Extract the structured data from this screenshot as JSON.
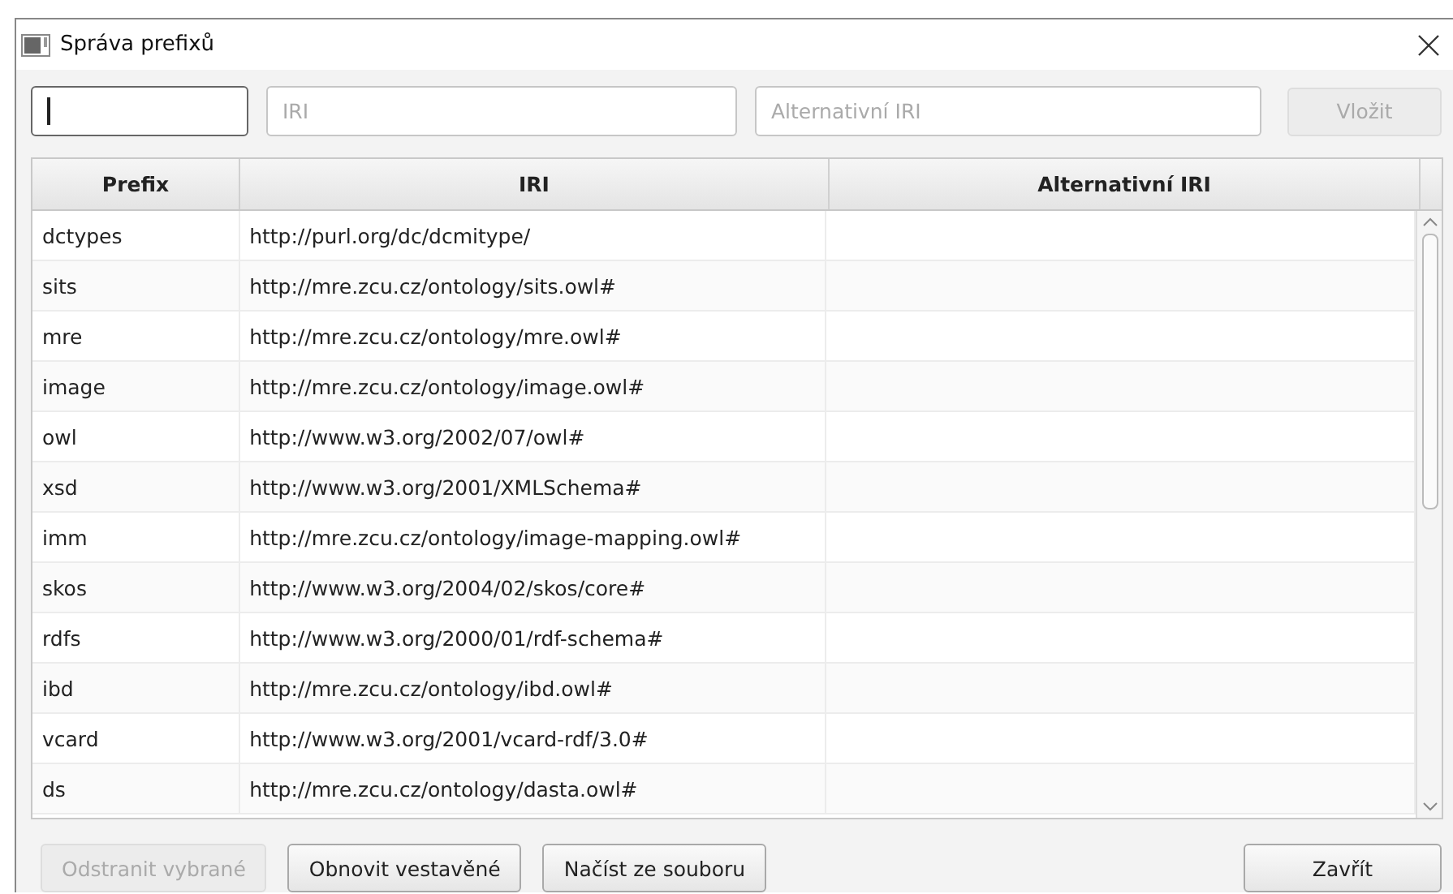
{
  "window": {
    "title": "Správa prefixů"
  },
  "fields": [
    {
      "kind": "prefix",
      "focused": true
    },
    {
      "kind": "iri",
      "placeholder": "IRI",
      "focused": false
    },
    {
      "kind": "alt",
      "placeholder": "Alternativní IRI",
      "focused": false
    }
  ],
  "insert_button": {
    "label": "Vložit",
    "disabled": true
  },
  "table": {
    "columns": [
      "Prefix",
      "IRI",
      "Alternativní IRI"
    ],
    "rows": [
      [
        "dctypes",
        "http://purl.org/dc/dcmitype/",
        ""
      ],
      [
        "sits",
        "http://mre.zcu.cz/ontology/sits.owl#",
        ""
      ],
      [
        "mre",
        "http://mre.zcu.cz/ontology/mre.owl#",
        ""
      ],
      [
        "image",
        "http://mre.zcu.cz/ontology/image.owl#",
        ""
      ],
      [
        "owl",
        "http://www.w3.org/2002/07/owl#",
        ""
      ],
      [
        "xsd",
        "http://www.w3.org/2001/XMLSchema#",
        ""
      ],
      [
        "imm",
        "http://mre.zcu.cz/ontology/image-mapping.owl#",
        ""
      ],
      [
        "skos",
        "http://www.w3.org/2004/02/skos/core#",
        ""
      ],
      [
        "rdfs",
        "http://www.w3.org/2000/01/rdf-schema#",
        ""
      ],
      [
        "ibd",
        "http://mre.zcu.cz/ontology/ibd.owl#",
        ""
      ],
      [
        "vcard",
        "http://www.w3.org/2001/vcard-rdf/3.0#",
        ""
      ],
      [
        "ds",
        "http://mre.zcu.cz/ontology/dasta.owl#",
        ""
      ]
    ]
  },
  "buttons": [
    {
      "label": "Odstranit vybrané",
      "disabled": true,
      "kind": "left"
    },
    {
      "label": "Obnovit vestavěné",
      "disabled": false,
      "kind": "left"
    },
    {
      "label": "Načíst ze souboru",
      "disabled": false,
      "kind": "left"
    },
    {
      "label": "Zavřít",
      "disabled": false,
      "kind": "right"
    }
  ]
}
